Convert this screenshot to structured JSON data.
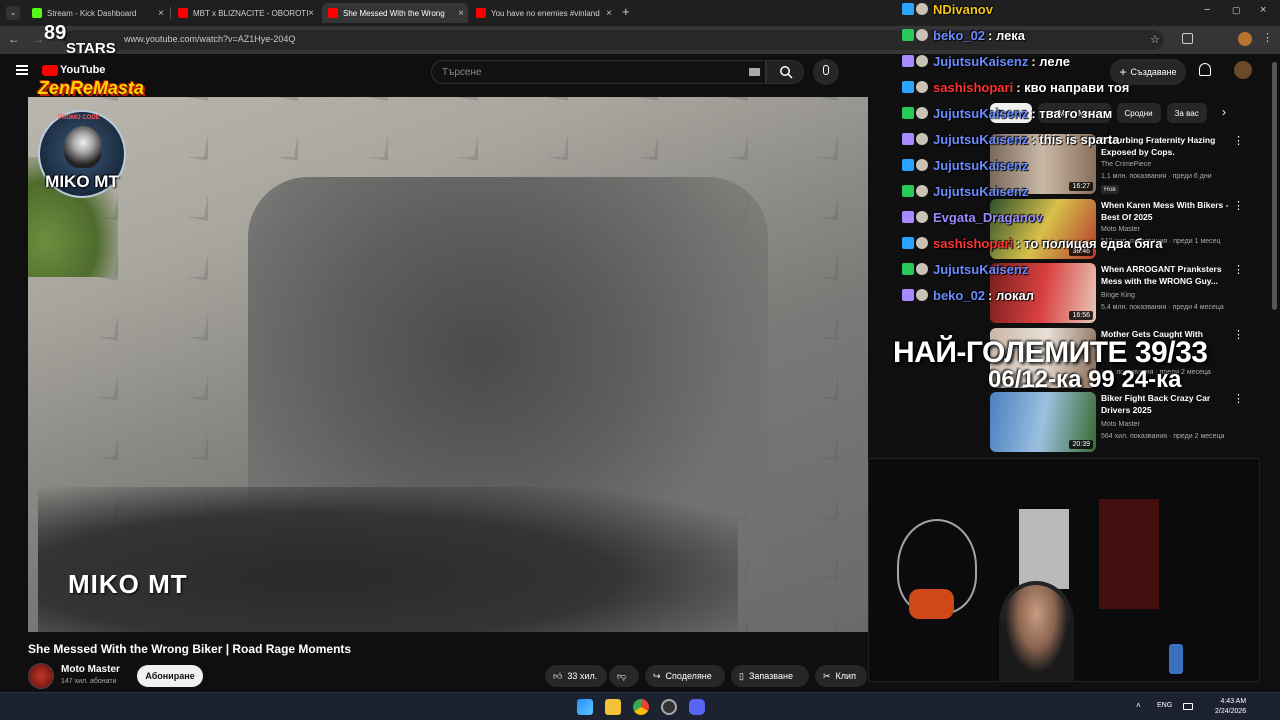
{
  "browser": {
    "tabs": [
      {
        "label": "Stream - Kick Dashboard",
        "favicon_color": "#53fc18",
        "active": false
      },
      {
        "label": "MBT x BLIZNACITE - OBOROTI",
        "favicon_color": "#ff0000",
        "active": false
      },
      {
        "label": "She Messed With the Wrong",
        "favicon_color": "#ff0000",
        "active": true
      },
      {
        "label": "You have no enemies #vinland",
        "favicon_color": "#ff0000",
        "active": false
      }
    ],
    "url": "www.youtube.com/watch?v=AZ1Hye-204Q"
  },
  "youtube": {
    "logo_text": "YouTube",
    "search_placeholder": "Търсене",
    "create_label": "Създаване"
  },
  "video": {
    "title": "She Messed With the Wrong Biker | Road Rage Moments",
    "watermark": "MIKO MT",
    "channel_name": "Moto Master",
    "subscribers": "147 хил. абонати",
    "subscribe_label": "Абониране",
    "likes": "33 хил.",
    "share_label": "Споделяне",
    "save_label": "Запазване",
    "clip_label": "Клип"
  },
  "recommendations": {
    "chips": [
      "Всички",
      "От Moto Master",
      "Сродни",
      "За вас"
    ],
    "items": [
      {
        "title": "Disturbing Fraternity Hazing Exposed by Cops.",
        "channel": "The CrimePiece",
        "meta": "1,1 млн. показвания · преди 6 дни",
        "duration": "16:27",
        "badge": "Нов"
      },
      {
        "title": "When Karen Mess With Bikers - Best Of 2025",
        "channel": "Moto Master",
        "meta": "518 хил. показвания · преди 1 месец",
        "duration": "38:46",
        "badge": ""
      },
      {
        "title": "When ARROGANT Pranksters Mess with the WRONG Guy...",
        "channel": "Binge King",
        "meta": "5,4 млн. показвания · преди 4 месеца",
        "duration": "16:56",
        "badge": ""
      },
      {
        "title": "Mother Gets Caught With",
        "channel": "",
        "meta": "хил. показвания · преди 2 месеца",
        "duration": "",
        "badge": ""
      },
      {
        "title": "Biker Fight Back Crazy Car Drivers 2025",
        "channel": "Moto Master",
        "meta": "564 хил. показвания · преди 2 месеца",
        "duration": "20:39",
        "badge": ""
      }
    ]
  },
  "chat": [
    {
      "user": "NDivanov",
      "msg": "",
      "color": "#f5c518"
    },
    {
      "user": "beko_02",
      "msg": ": лека",
      "color": "#6a8cff"
    },
    {
      "user": "JujutsuKaisenz",
      "msg": ": леле",
      "color": "#6a8cff"
    },
    {
      "user": "sashishopari",
      "msg": ": кво направи тоя",
      "color": "#ff3333"
    },
    {
      "user": "JujutsuKaisenz",
      "msg": ": тва го знам",
      "color": "#6a8cff"
    },
    {
      "user": "JujutsuKaisenz",
      "msg": ": this is sparta",
      "color": "#6a8cff"
    },
    {
      "user": "JujutsuKaisenz",
      "msg": "",
      "color": "#6a8cff"
    },
    {
      "user": "JujutsuKaisenz",
      "msg": "",
      "color": "#6a8cff"
    },
    {
      "user": "Evgata_Draganov",
      "msg": "",
      "color": "#9b8cff"
    },
    {
      "user": "sashishopari",
      "msg": ": то полицая едва бяга",
      "color": "#ff3333"
    },
    {
      "user": "JujutsuKaisenz",
      "msg": "",
      "color": "#6a8cff"
    },
    {
      "user": "beko_02",
      "msg": ": локал",
      "color": "#6a8cff"
    }
  ],
  "overlay": {
    "headline": "НАЙ-ГОЛЕМИТЕ 39/33",
    "subline": "06/12-ка 99 24-ка",
    "brand_top": "89",
    "brand_stars": "STARS",
    "renemasta": "ZenReMasta",
    "promo": "PROMO CODE",
    "badge_text": "MIKO MT"
  },
  "taskbar": {
    "lang": "ENG",
    "time": "4:43 AM",
    "date": "2/24/2026"
  }
}
